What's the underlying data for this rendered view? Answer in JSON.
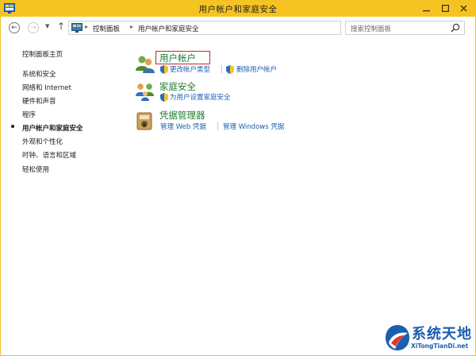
{
  "window": {
    "title": "用户帐户和家庭安全",
    "accent_color": "#f6c321",
    "controls": {
      "minimize_icon": "minimize-icon",
      "maximize_icon": "maximize-icon",
      "close_icon": "close-icon"
    }
  },
  "navbar": {
    "back_icon": "back-arrow-icon",
    "forward_icon": "forward-arrow-icon",
    "recent_icon": "chevron-down-icon",
    "up_icon": "up-arrow-icon",
    "breadcrumbs": [
      "控制面板",
      "用户帐户和家庭安全"
    ],
    "refresh_icon": "refresh-icon",
    "search": {
      "placeholder": "搜索控制面板",
      "icon": "search-icon"
    }
  },
  "sidebar": {
    "items": [
      {
        "label": "控制面板主页",
        "current": false
      },
      {
        "label": "系统和安全",
        "current": false
      },
      {
        "label": "网络和 Internet",
        "current": false
      },
      {
        "label": "硬件和声音",
        "current": false
      },
      {
        "label": "程序",
        "current": false
      },
      {
        "label": "用户帐户和家庭安全",
        "current": true
      },
      {
        "label": "外观和个性化",
        "current": false
      },
      {
        "label": "时钟、语言和区域",
        "current": false
      },
      {
        "label": "轻松使用",
        "current": false
      }
    ]
  },
  "main": {
    "categories": [
      {
        "title": "用户帐户",
        "icon": "user-accounts-icon",
        "highlighted": true,
        "tasks": [
          {
            "label": "更改帐户类型",
            "shield": true
          },
          {
            "label": "删除用户帐户",
            "shield": true
          }
        ]
      },
      {
        "title": "家庭安全",
        "icon": "family-safety-icon",
        "highlighted": false,
        "tasks": [
          {
            "label": "为用户设置家庭安全",
            "shield": true
          }
        ]
      },
      {
        "title": "凭据管理器",
        "icon": "credential-manager-icon",
        "highlighted": false,
        "tasks": [
          {
            "label": "管理 Web 凭据",
            "shield": false
          },
          {
            "label": "管理 Windows 凭据",
            "shield": false
          }
        ]
      }
    ],
    "link_color": "#1a5fb4",
    "title_color": "#1e7d2f",
    "highlight_color": "#d42222"
  },
  "watermark": {
    "title": "系统天地",
    "url": "XiTongTianDi.net"
  }
}
